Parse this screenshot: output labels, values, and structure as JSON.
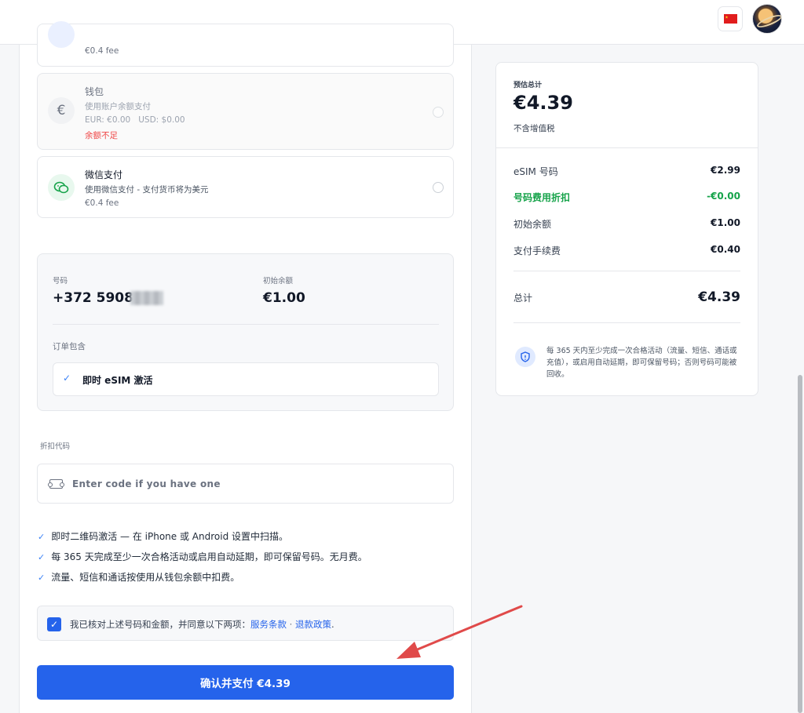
{
  "payment_methods": {
    "card_top": {
      "fee": "€0.4 fee"
    },
    "wallet": {
      "title": "钱包",
      "desc": "使用账户余额支付",
      "balance": "EUR: €0.00   USD: $0.00",
      "warning": "余额不足",
      "icon": "euro-icon"
    },
    "wechat": {
      "title": "微信支付",
      "desc": "使用微信支付 - 支付货币将为美元",
      "fee": "€0.4 fee",
      "icon": "wechat-icon"
    }
  },
  "order": {
    "number_label": "号码",
    "number_value": "+372 5908",
    "balance_label": "初始余额",
    "balance_value": "€1.00",
    "includes_label": "订单包含",
    "includes_item": "即时 eSIM 激活"
  },
  "discount": {
    "label": "折扣代码",
    "placeholder": "Enter code if you have one"
  },
  "features": [
    "即时二维码激活 — 在 iPhone 或 Android 设置中扫描。",
    "每 365 天完成至少一次合格活动或启用自动延期，即可保留号码。无月费。",
    "流量、短信和通话按使用从钱包余额中扣费。"
  ],
  "agreement": {
    "text": "我已核对上述号码和金额，并同意以下两项：",
    "terms_link": "服务条款",
    "sep": " · ",
    "refund_link": "退款政策",
    "end": "."
  },
  "pay_button": "确认并支付 €4.39",
  "summary": {
    "estimated_label": "预估总计",
    "estimated_value": "€4.39",
    "vat_note": "不含增值税",
    "rows": [
      {
        "label": "eSIM 号码",
        "value": "€2.99"
      },
      {
        "label": "号码费用折扣",
        "value": "-€0.00"
      },
      {
        "label": "初始余额",
        "value": "€1.00"
      },
      {
        "label": "支付手续费",
        "value": "€0.40"
      }
    ],
    "total_label": "总计",
    "total_value": "€4.39",
    "note": "每 365 天内至少完成一次合格活动（流量、短信、通话或充值），或启用自动延期，即可保留号码；否则号码可能被回收。"
  },
  "colors": {
    "accent": "#2563eb",
    "discount_green": "#16a34a",
    "warning": "#ef4444",
    "arrow": "#e04a4a"
  }
}
